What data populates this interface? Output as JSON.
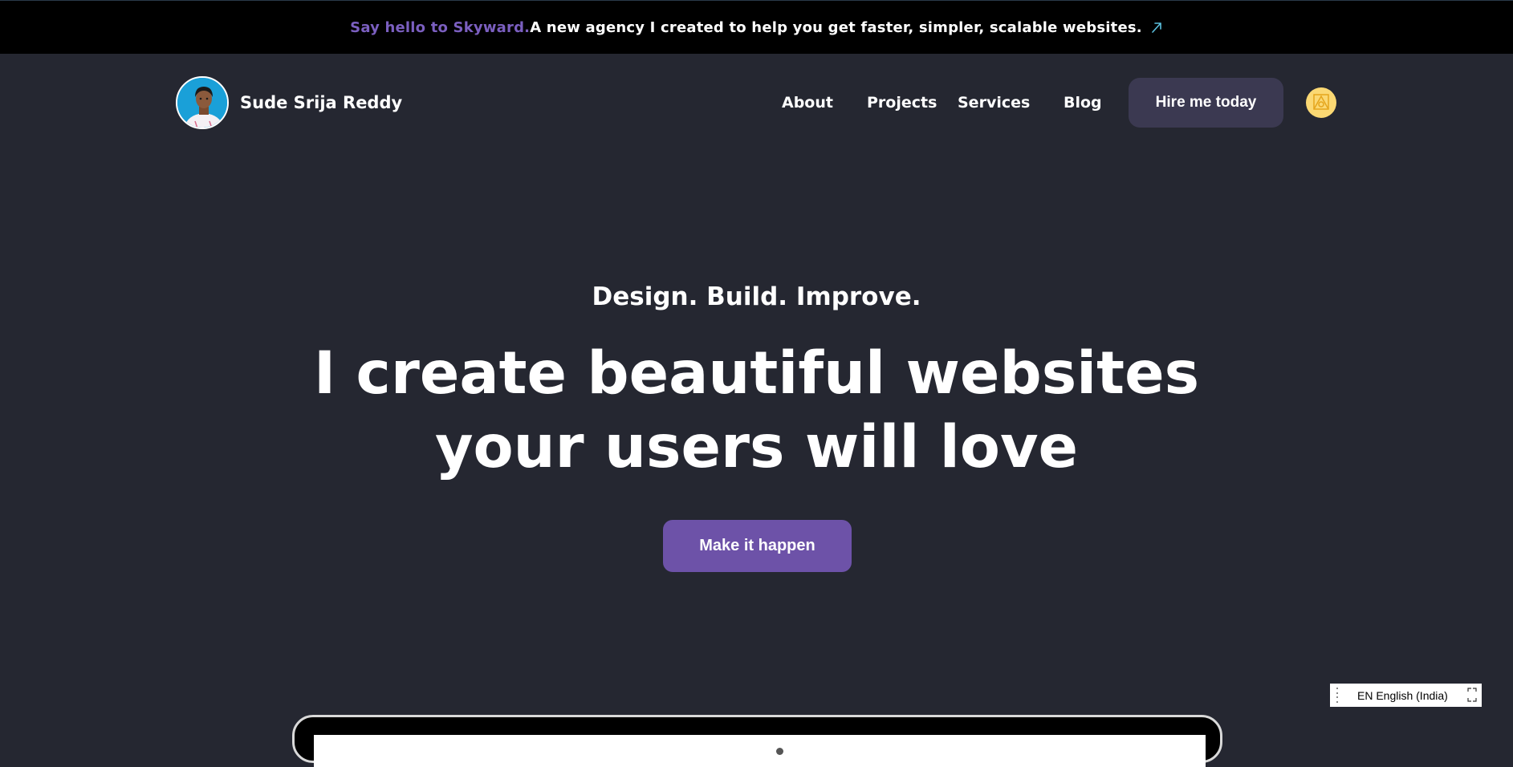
{
  "announcement": {
    "highlight": "Say hello to Skyward.",
    "message": "A new agency I created to help you get faster, simpler, scalable websites.",
    "arrow_icon": "arrow-up-right-icon",
    "colors": {
      "highlight": "#7b5fc0",
      "background": "#000000"
    }
  },
  "header": {
    "brand_name": "Sude Srija Reddy",
    "nav": [
      {
        "label": "About"
      },
      {
        "label": "Projects"
      },
      {
        "label": "Services"
      },
      {
        "label": "Blog"
      }
    ],
    "hire_label": "Hire me today",
    "theme_icon": "theme-toggle-icon"
  },
  "hero": {
    "kicker": "Design. Build. Improve.",
    "title_line1": "I create beautiful websites",
    "title_line2": "your users will love",
    "cta_label": "Make it happen",
    "colors": {
      "cta": "#6d52a8",
      "background": "#252731"
    }
  },
  "language_widget": {
    "label": "EN English (India)"
  }
}
